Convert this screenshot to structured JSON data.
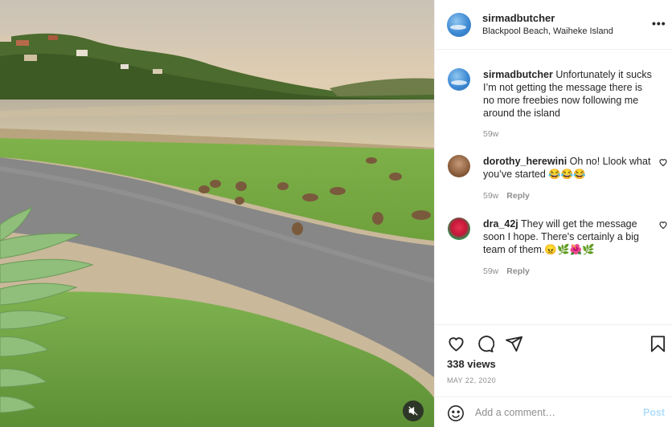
{
  "post": {
    "username": "sirmadbutcher",
    "location": "Blackpool Beach, Waiheke Island",
    "more_label": "•••"
  },
  "comments": [
    {
      "username": "sirmadbutcher",
      "text": "Unfortunately it sucks I’m not getting the message there is no more freebies now following me around the island",
      "time": "59w",
      "reply": ""
    },
    {
      "username": "dorothy_herewini",
      "text": "Oh no! Llook what you’ve started 😂😂😂",
      "time": "59w",
      "reply": "Reply"
    },
    {
      "username": "dra_42j",
      "text": "They will get the message soon I hope. There's certainly a big team of them.😠🌿🌺🌿",
      "time": "59w",
      "reply": "Reply"
    }
  ],
  "stats": {
    "views": "338 views",
    "date": "MAY 22, 2020"
  },
  "composer": {
    "placeholder": "Add a comment…",
    "post_label": "Post"
  },
  "icons": {
    "like": "heart-icon",
    "comment": "comment-bubble-icon",
    "share": "paper-plane-icon",
    "save": "bookmark-icon",
    "emoji": "smiley-icon",
    "mute": "speaker-muted-icon",
    "more": "more-options-icon"
  },
  "colors": {
    "primary_text": "#262626",
    "secondary_text": "#8e8e8e",
    "border": "#efefef",
    "post_button_disabled": "#b2dffc"
  }
}
